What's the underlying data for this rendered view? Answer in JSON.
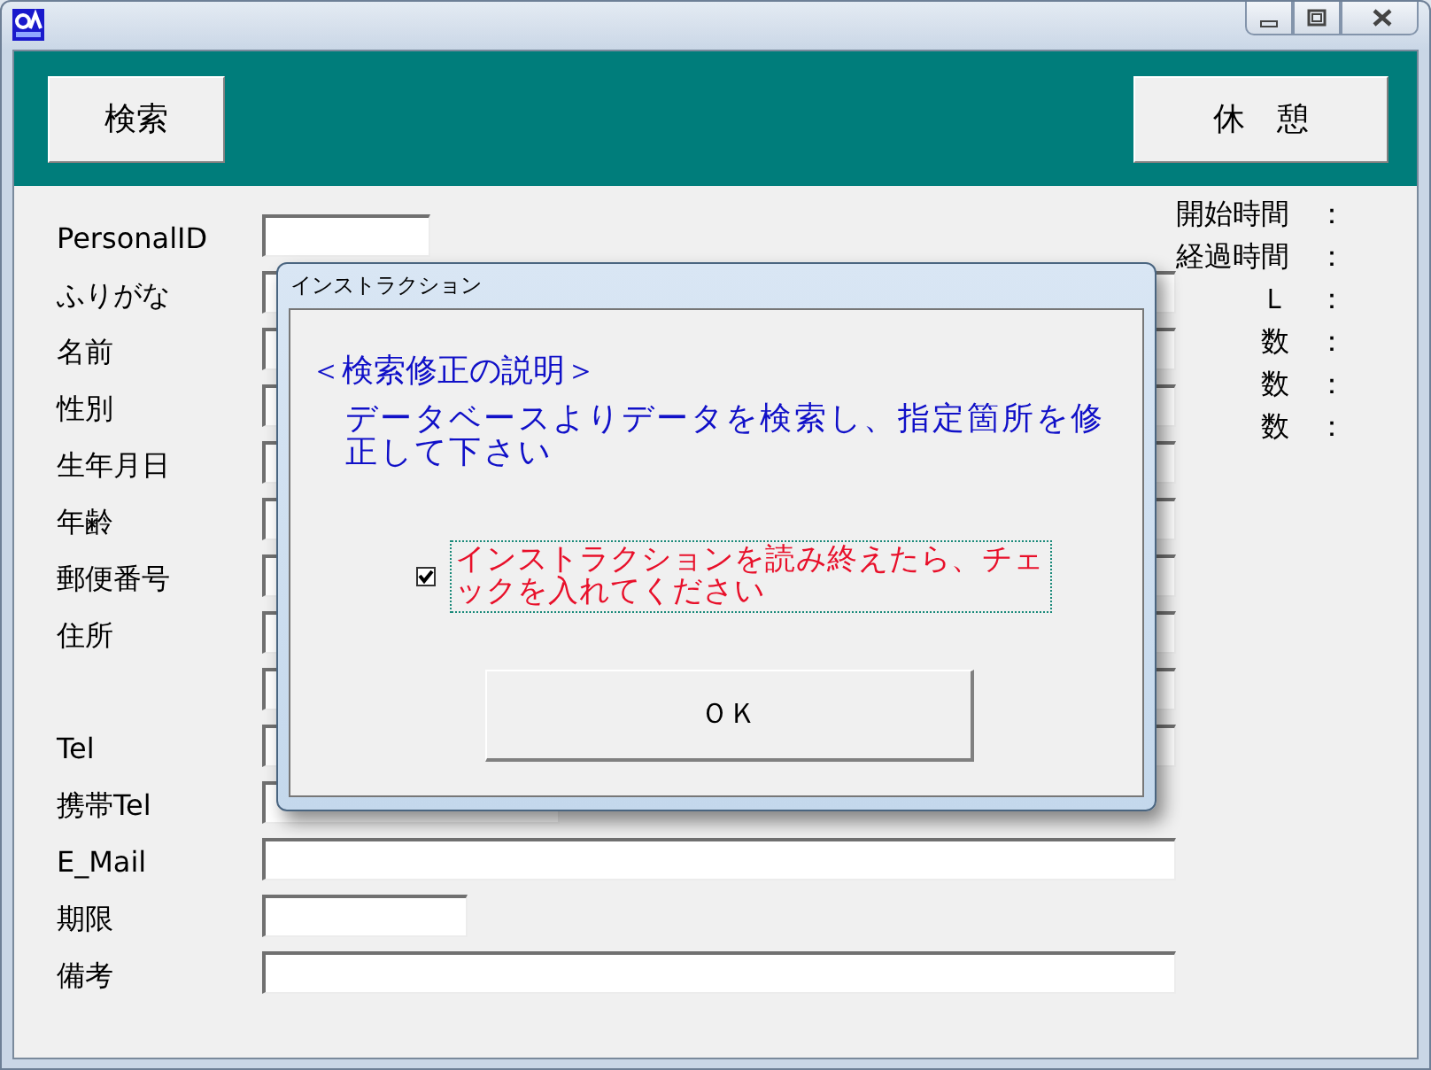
{
  "toolbar": {
    "buttons": [
      "検索",
      "休　憩"
    ]
  },
  "form": {
    "rows": [
      {
        "label": "PersonalID",
        "kind": "short"
      },
      {
        "label": "ふりがな",
        "kind": "long"
      },
      {
        "label": "名前",
        "kind": "long"
      },
      {
        "label": "性別",
        "kind": "long"
      },
      {
        "label": "生年月日",
        "kind": "long"
      },
      {
        "label": "年齢",
        "kind": "long"
      },
      {
        "label": "郵便番号",
        "kind": "long"
      },
      {
        "label": "住所",
        "kind": "double"
      },
      {
        "label": "Tel",
        "kind": "long"
      },
      {
        "label": "携帯Tel",
        "kind": "medium"
      },
      {
        "label": "E_Mail",
        "kind": "long"
      },
      {
        "label": "期限",
        "kind": "short"
      },
      {
        "label": "備考",
        "kind": "long"
      }
    ]
  },
  "info": [
    "開始時間　：",
    "経過時間　：",
    "Ｌ　：",
    "数　：",
    "数　：",
    "数　："
  ],
  "dialog": {
    "title": "インストラクション",
    "heading": "＜検索修正の説明＞",
    "body": "データベースよりデータを検索し、指定箇所を修正して下さい",
    "checkbox": {
      "label": "インストラクションを読み終えたら、チェックを入れてください",
      "checked": true
    },
    "button": "ＯＫ"
  }
}
